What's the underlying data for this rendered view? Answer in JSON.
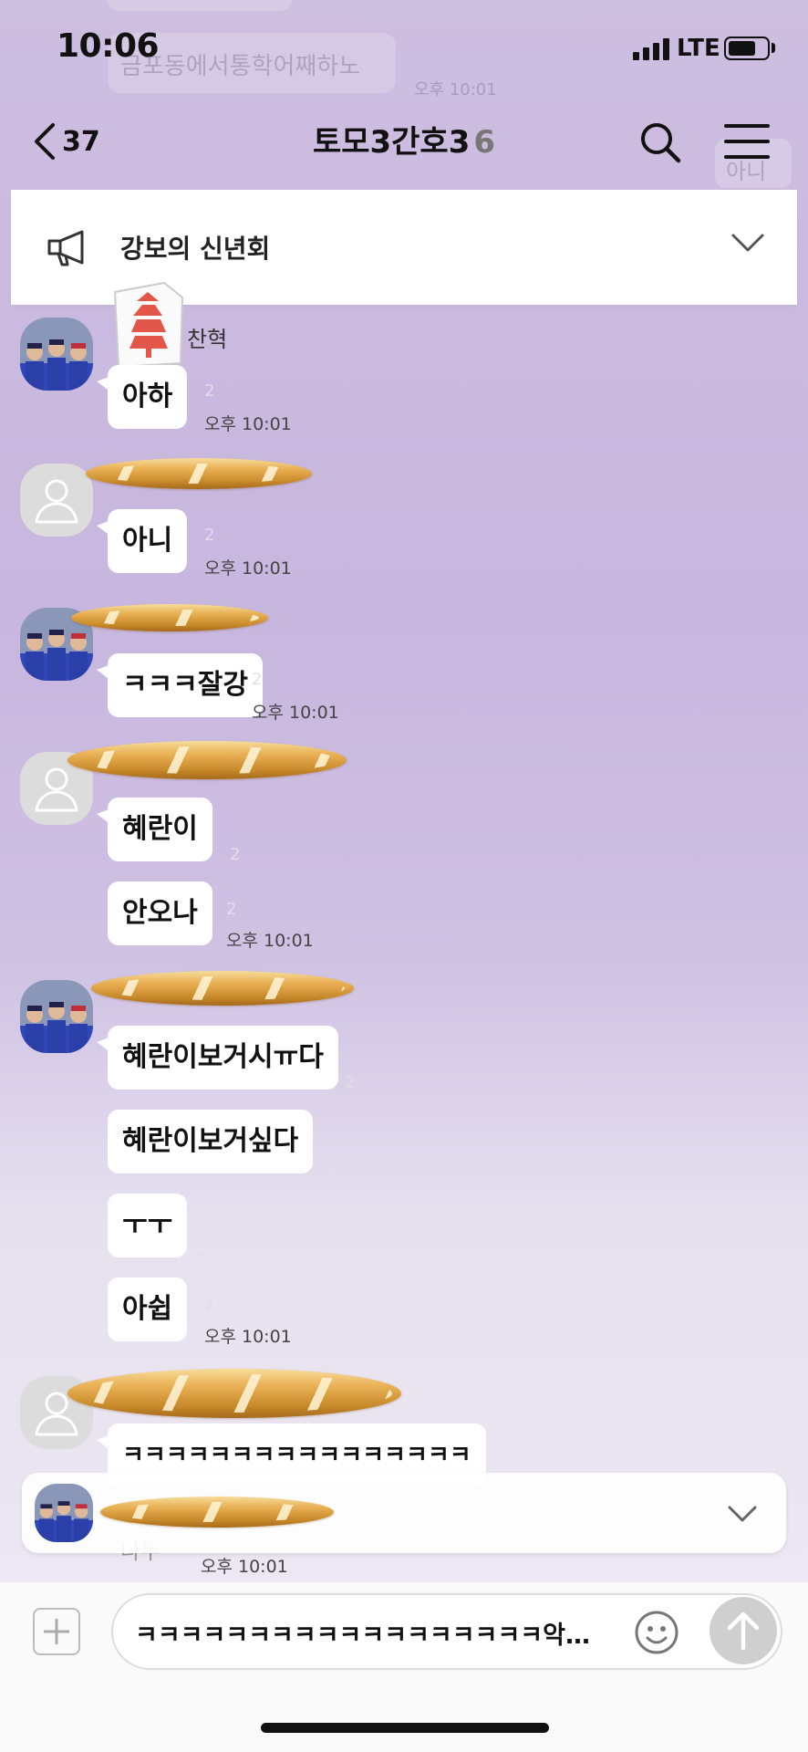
{
  "status_bar": {
    "time": "10:06",
    "network": "LTE"
  },
  "ghost": {
    "message": "금포동에서통학어째하노",
    "time": "오후 10:01",
    "right_message": "아니"
  },
  "header": {
    "back_count": "37",
    "chat_title": "토모3간호3",
    "member_count": "6"
  },
  "notice": {
    "text": "강보의 신년회"
  },
  "messages": [
    {
      "sender": "찬혁",
      "bubbles": [
        "아하"
      ],
      "unread": "2",
      "time": "오후 10:01"
    },
    {
      "sender": "",
      "bubbles": [
        "아니"
      ],
      "unread": "2",
      "time": "오후 10:01"
    },
    {
      "sender": "",
      "bubbles": [
        "ㅋㅋㅋ잘강"
      ],
      "unread": "2",
      "time": "오후 10:01"
    },
    {
      "sender": "",
      "bubbles": [
        "혜란이",
        "안오나"
      ],
      "unread": [
        "2",
        "2"
      ],
      "time": "오후 10:01"
    },
    {
      "sender": "",
      "bubbles": [
        "혜란이보거시ㅠ다",
        "혜란이보거싶다",
        "ㅜㅜ",
        "아쉽"
      ],
      "unread": [
        "2",
        "2",
        "2",
        "2"
      ],
      "time": "오후 10:01"
    },
    {
      "sender": "",
      "bubbles": [
        "ㅋㅋㅋㅋㅋㅋㅋㅋㅋㅋㅋㅋㅋㅋㅋㅋ"
      ],
      "unread": "",
      "time": ""
    }
  ],
  "preview": {
    "trailing_text": "나누",
    "time": "오후 10:01"
  },
  "composer": {
    "text": "ㅋㅋㅋㅋㅋㅋㅋㅋㅋㅋㅋㅋㅋㅋㅋㅋㅋㅋ악ㅋㅋㅋㅋㅋㅠㅠㅠ..."
  },
  "colors": {
    "background": "#c9b9df",
    "bubble": "#ffffff",
    "accent_bread": "#e9b055"
  },
  "icons": [
    "chevron-left-icon",
    "search-icon",
    "menu-icon",
    "megaphone-icon",
    "chevron-down-icon",
    "default-user-icon",
    "plus-icon",
    "emoji-icon",
    "send-arrow-icon"
  ]
}
